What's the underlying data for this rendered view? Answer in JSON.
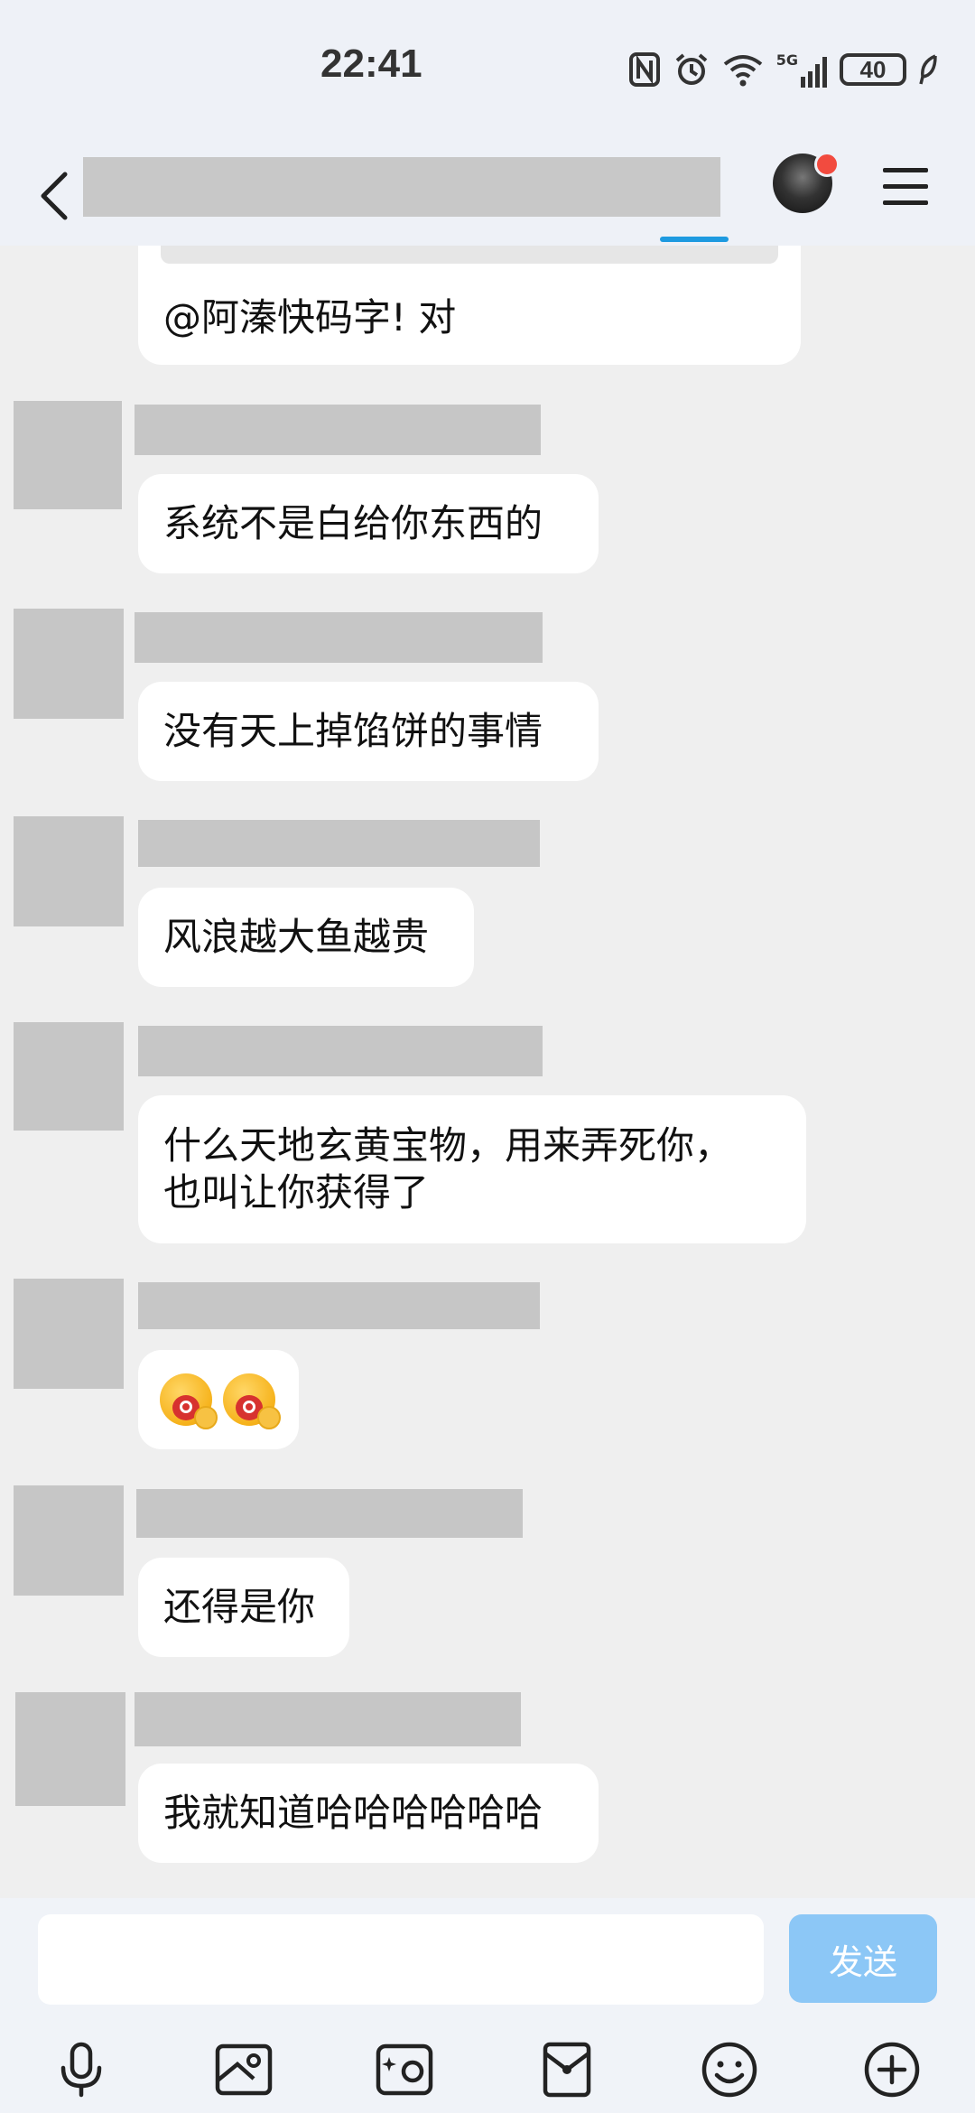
{
  "status_bar": {
    "time": "22:41",
    "network": "5G",
    "battery": "40"
  },
  "header": {
    "title": ""
  },
  "messages": [
    {
      "text": "@阿溱快码字! 对"
    },
    {
      "text": "系统不是白给你东西的"
    },
    {
      "text": "没有天上掉馅饼的事情"
    },
    {
      "text": "风浪越大鱼越贵"
    },
    {
      "text": "什么天地玄黄宝物，用来弄死你，\n也叫让你获得了"
    },
    {
      "text": "",
      "emoji": [
        "lollipop-face-emoji",
        "lollipop-face-emoji"
      ]
    },
    {
      "text": "还得是你"
    },
    {
      "text": "我就知道哈哈哈哈哈哈"
    }
  ],
  "composer": {
    "placeholder": "",
    "send_label": "发送"
  },
  "toolbar": [
    "microphone-icon",
    "image-icon",
    "camera-icon",
    "red-packet-icon",
    "emoji-icon",
    "plus-icon"
  ],
  "colors": {
    "accent": "#1e9ae0",
    "send_disabled": "#8cc7f6",
    "background": "#efefef",
    "badge": "#f24b3f"
  }
}
